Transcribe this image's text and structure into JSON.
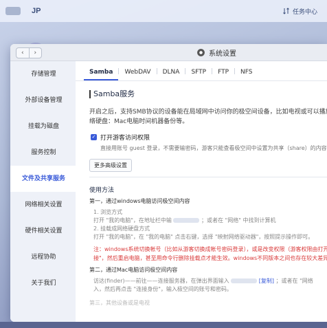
{
  "topbar": {
    "logo_text": "JP",
    "task_manager": "任务中心"
  },
  "window": {
    "title": "系统设置",
    "nav_back": "‹",
    "nav_forward": "›"
  },
  "sidebar": {
    "items": [
      {
        "label": "存储管理"
      },
      {
        "label": "外部设备管理"
      },
      {
        "label": "挂载为磁盘"
      },
      {
        "label": "服务控制"
      },
      {
        "label": "文件及共享服务"
      },
      {
        "label": "网络相关设置"
      },
      {
        "label": "硬件相关设置"
      },
      {
        "label": "远程协助"
      },
      {
        "label": "关于我们"
      }
    ],
    "active_index": 4
  },
  "tabs": [
    {
      "label": "Samba"
    },
    {
      "label": "WebDAV"
    },
    {
      "label": "DLNA"
    },
    {
      "label": "SFTP"
    },
    {
      "label": "FTP"
    },
    {
      "label": "NFS"
    }
  ],
  "samba": {
    "title": "Samba服务",
    "description_line1": "开启之后，支持SMB协议的设备能在局域网中访问你的极空间设备，比如电视或可以播放极空间",
    "description_line2": "络硬盘：Mac电脑时间机器备份等。",
    "guest_checkbox_label": "打开游客访问权限",
    "guest_checkbox_checked": true,
    "guest_note": "直接用账号 guest 登录，不需要输密码，游客只能查看极空间中设置为共享（share）的内容，无写",
    "advanced_button": "更多高级设置"
  },
  "usage": {
    "title": "使用方法",
    "step1": "第一，通过windows电脑访问极空间内容",
    "step1_method1": "1. 浏览方式",
    "step1_method1_detail_a": "打开 \"我的电脑\"，在地址栏中输",
    "step1_method1_detail_b": "；或者在 \"网络\" 中找到计算机",
    "step1_method2": "2. 挂载成网络硬盘方式",
    "step1_method2_detail": "打开 \"我的电脑\"，在 \"我的电脑\" 点击右键，选择 \"映射网络驱动器\"，按照提示操作即可。",
    "step1_note_line1": "注：windows系统切换帐号（比如从游客切换成帐号密码登录），或是改变权限（游客权限由打开变为",
    "step1_note_line2": "接\"，然后重启电脑，甚至用命令行删除挂载点才能生效。windows不同版本之间也存在较大差异，需",
    "step2": "第二，通过Mac电脑访问极空间内容",
    "step2_detail_a": "访达(finder)——前往——连接服务器，在弹出界面输入",
    "step2_copy": "[复制]",
    "step2_detail_b": "；或者在 \"网络",
    "step2_detail_line2": "入，然后再点击 \"连接身份\"，输入极空间的账号和密码。",
    "step3_partial": "第三，其他设备或是电视"
  }
}
